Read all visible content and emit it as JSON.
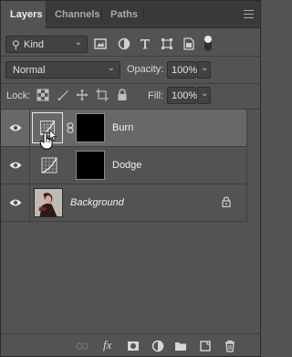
{
  "tabs": [
    {
      "label": "Layers",
      "active": true
    },
    {
      "label": "Channels",
      "active": false
    },
    {
      "label": "Paths",
      "active": false
    }
  ],
  "filter": {
    "kind_label": "Kind",
    "icons": [
      "pixel-filter-icon",
      "adjustment-filter-icon",
      "type-filter-icon",
      "shape-filter-icon",
      "smart-object-filter-icon"
    ]
  },
  "blend": {
    "mode": "Normal",
    "opacity_label": "Opacity:",
    "opacity_value": "100%"
  },
  "lock": {
    "label": "Lock:",
    "fill_label": "Fill:",
    "fill_value": "100%"
  },
  "layers": [
    {
      "name": "Burn",
      "type": "adjustment",
      "visible": true,
      "selected": true
    },
    {
      "name": "Dodge",
      "type": "adjustment",
      "visible": true,
      "selected": false
    },
    {
      "name": "Background",
      "type": "image",
      "visible": true,
      "selected": false,
      "locked": true
    }
  ],
  "colors": {
    "panel_bg": "#535353",
    "selected_row": "#686868",
    "tabbar_bg": "#3a3a3a"
  },
  "bottom_icons": [
    "link-layers-icon",
    "fx-icon",
    "add-mask-icon",
    "new-adjustment-icon",
    "new-group-icon",
    "new-layer-icon",
    "delete-icon"
  ]
}
